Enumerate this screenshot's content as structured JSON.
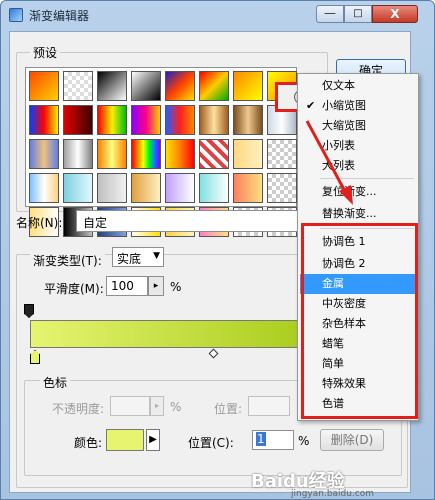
{
  "window": {
    "title": "渐变编辑器",
    "min_label": "—",
    "max_label": "□",
    "close_label": "X"
  },
  "presets": {
    "label": "预设",
    "swatches": [
      "linear-gradient(135deg,#ff4a00,#ffd000)",
      "repeating-conic-gradient(#ddd 0 25%,#fff 0 50%) 0 0/8px 8px",
      "linear-gradient(135deg,#000,#fff)",
      "linear-gradient(135deg,#fff,#000)",
      "linear-gradient(135deg,#2020c0,#ff4000,#ffe000)",
      "linear-gradient(135deg,#ff0000,#ffcc00,#00aa00)",
      "linear-gradient(135deg,#ff8800,#ffff00)",
      "linear-gradient(135deg,#ffff00,#ff8800)",
      "linear-gradient(90deg,#0040ff,#ff0000,#ffee00)",
      "linear-gradient(90deg,#e00000,#400000)",
      "linear-gradient(90deg,#ff0000,#ffee00,#00c000)",
      "linear-gradient(90deg,#8800ff,#ff0088,#ffcc00)",
      "linear-gradient(90deg,#2060ff,#ff2020,#ff8800)",
      "linear-gradient(90deg,#a06020,#ffe0a0,#a06020)",
      "linear-gradient(90deg,#7a5020,#f0c890,#7a5020)",
      "linear-gradient(90deg,#d0d8e8,#fff,#b0b8c8)",
      "linear-gradient(90deg,#6080e0,#f0c080,#6080e0)",
      "linear-gradient(90deg,#a0a0a0,#fff,#808080)",
      "linear-gradient(90deg,#ff8000,#ffff80,#ff8000)",
      "linear-gradient(90deg,#ff0000,#ff8000,#ffff00,#00ff00,#0080ff,#8000ff)",
      "linear-gradient(90deg,#ffe000,#ff8000,#ff0000)",
      "repeating-linear-gradient(45deg,#e04040 0 4px,#fff 4px 8px)",
      "linear-gradient(90deg,#ffd880,#fff0c0)",
      "repeating-conic-gradient(#ccc 0 25%,#fff 0 50%) 0 0/8px 8px",
      "linear-gradient(90deg,#80c0ff,#fff,#ffd080)",
      "linear-gradient(90deg,#80d0e0,#e0f8ff)",
      "linear-gradient(90deg,#c0c0c0,#f0f0f0)",
      "linear-gradient(90deg,#e0a040,#fff0c0)",
      "linear-gradient(90deg,#c0a0ff,#fff)",
      "linear-gradient(90deg,#80e0e0,#fff)",
      "linear-gradient(90deg,#ff8060,#ffe080)",
      "repeating-conic-gradient(#ccc 0 25%,#fff 0 50%) 0 0/8px 8px",
      "linear-gradient(90deg,#ffe080,#fff)",
      "linear-gradient(90deg,#000,#c0c0c0)",
      "linear-gradient(90deg,#204080,#80a0e0)",
      "linear-gradient(90deg,#fff,#ffe000)",
      "linear-gradient(90deg,#ffd040,#fff8c0)",
      "linear-gradient(90deg,#ff80c0,#ffe080)",
      "repeating-conic-gradient(#ccc 0 25%,#fff 0 50%) 0 0/8px 8px",
      "repeating-conic-gradient(#ccc 0 25%,#fff 0 50%) 0 0/8px 8px"
    ]
  },
  "ok_button": "确定",
  "name": {
    "label": "名称(N):",
    "value": "自定"
  },
  "gradient": {
    "type_label": "渐变类型(T):",
    "type_value": "实底",
    "smooth_label": "平滑度(M):",
    "smooth_value": "100",
    "smooth_unit": "%"
  },
  "stops": {
    "label": "色标",
    "opacity_label": "不透明度:",
    "opacity_unit": "%",
    "location_label_disabled": "位置:",
    "location_unit_disabled": "%",
    "color_label": "颜色:",
    "location_label": "位置(C):",
    "location_value": "1",
    "location_unit": "%",
    "delete_label": "删除(D)",
    "color_value": "#e6f470"
  },
  "menu": {
    "items": [
      {
        "label": "仅文本",
        "checked": false
      },
      {
        "label": "小缩览图",
        "checked": true
      },
      {
        "label": "大缩览图",
        "checked": false
      },
      {
        "label": "小列表",
        "checked": false
      },
      {
        "label": "大列表",
        "checked": false
      },
      {
        "label": "复位渐变...",
        "checked": false
      },
      {
        "label": "替换渐变...",
        "checked": false
      },
      {
        "label": "协调色 1",
        "checked": false
      },
      {
        "label": "协调色 2",
        "checked": false
      },
      {
        "label": "金属",
        "checked": false,
        "highlighted": true
      },
      {
        "label": "中灰密度",
        "checked": false
      },
      {
        "label": "杂色样本",
        "checked": false
      },
      {
        "label": "蜡笔",
        "checked": false
      },
      {
        "label": "简单",
        "checked": false
      },
      {
        "label": "特殊效果",
        "checked": false
      },
      {
        "label": "色谱",
        "checked": false
      }
    ]
  },
  "watermark": {
    "text": "Baidu经验",
    "sub": "jingyan.baidu.com"
  },
  "colors": {
    "highlight": "#3399ff",
    "annotation_red": "#e0201c",
    "gradient_start": "#e6f470",
    "gradient_end": "#a8cc1c"
  }
}
